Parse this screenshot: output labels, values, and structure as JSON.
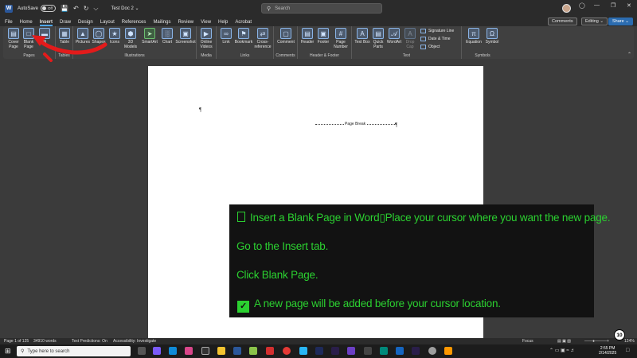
{
  "titlebar": {
    "autosave_label": "AutoSave",
    "autosave_state": "Off",
    "doc_name": "Test Doc 2 ⌄",
    "search_placeholder": "Search"
  },
  "menu": {
    "tabs": [
      "File",
      "Home",
      "Insert",
      "Draw",
      "Design",
      "Layout",
      "References",
      "Mailings",
      "Review",
      "View",
      "Help",
      "Acrobat"
    ],
    "active_tab": "Insert",
    "comments_label": "Comments",
    "editing_label": "Editing ⌄",
    "share_label": "Share ⌄"
  },
  "ribbon": {
    "pages": {
      "label": "Pages",
      "cover": "Cover Page",
      "blank": "Blank Page",
      "break": "Bl"
    },
    "tables": {
      "label": "Tables",
      "table": "Table"
    },
    "illustrations": {
      "label": "Illustrations",
      "pictures": "Pictures",
      "shapes": "Shapes",
      "icons": "Icons",
      "models": "3D Models",
      "smartart": "SmartArt",
      "chart": "Chart",
      "screenshot": "Screenshot"
    },
    "media": {
      "label": "Media",
      "online_videos": "Online Videos"
    },
    "links": {
      "label": "Links",
      "link": "Link",
      "bookmark": "Bookmark",
      "cross_ref": "Cross-reference"
    },
    "comments": {
      "label": "Comments",
      "comment": "Comment"
    },
    "header_footer": {
      "label": "Header & Footer",
      "header": "Header",
      "footer": "Footer",
      "page_number": "Page Number"
    },
    "text": {
      "label": "Text",
      "text_box": "Text Box",
      "quick_parts": "Quick Parts",
      "wordart": "WordArt",
      "drop_cap": "Drop Cap",
      "signature_line": "Signature Line",
      "date_time": "Date & Time",
      "object": "Object"
    },
    "symbols": {
      "label": "Symbols",
      "equation": "Equation",
      "symbol": "Symbol"
    }
  },
  "document": {
    "pilcrow": "¶",
    "page_break_label": "Page Break"
  },
  "overlay": {
    "line1": "Insert a Blank Page in Word▯Place your cursor where you want the new page.",
    "line2": "Go to the Insert tab.",
    "line3": "Click Blank Page.",
    "line4": "A new page will be added before your cursor location.",
    "text_color": "#2bd130"
  },
  "statusbar": {
    "page": "Page 1 of 125",
    "words": "34910 words",
    "predictions": "Text Predictions: On",
    "accessibility": "Accessibility: Investigate",
    "focus": "Focus",
    "zoom": "124%",
    "step": "10"
  },
  "taskbar": {
    "search_placeholder": "Type here to search",
    "time": "2:55 PM",
    "date": "2/14/2025"
  }
}
